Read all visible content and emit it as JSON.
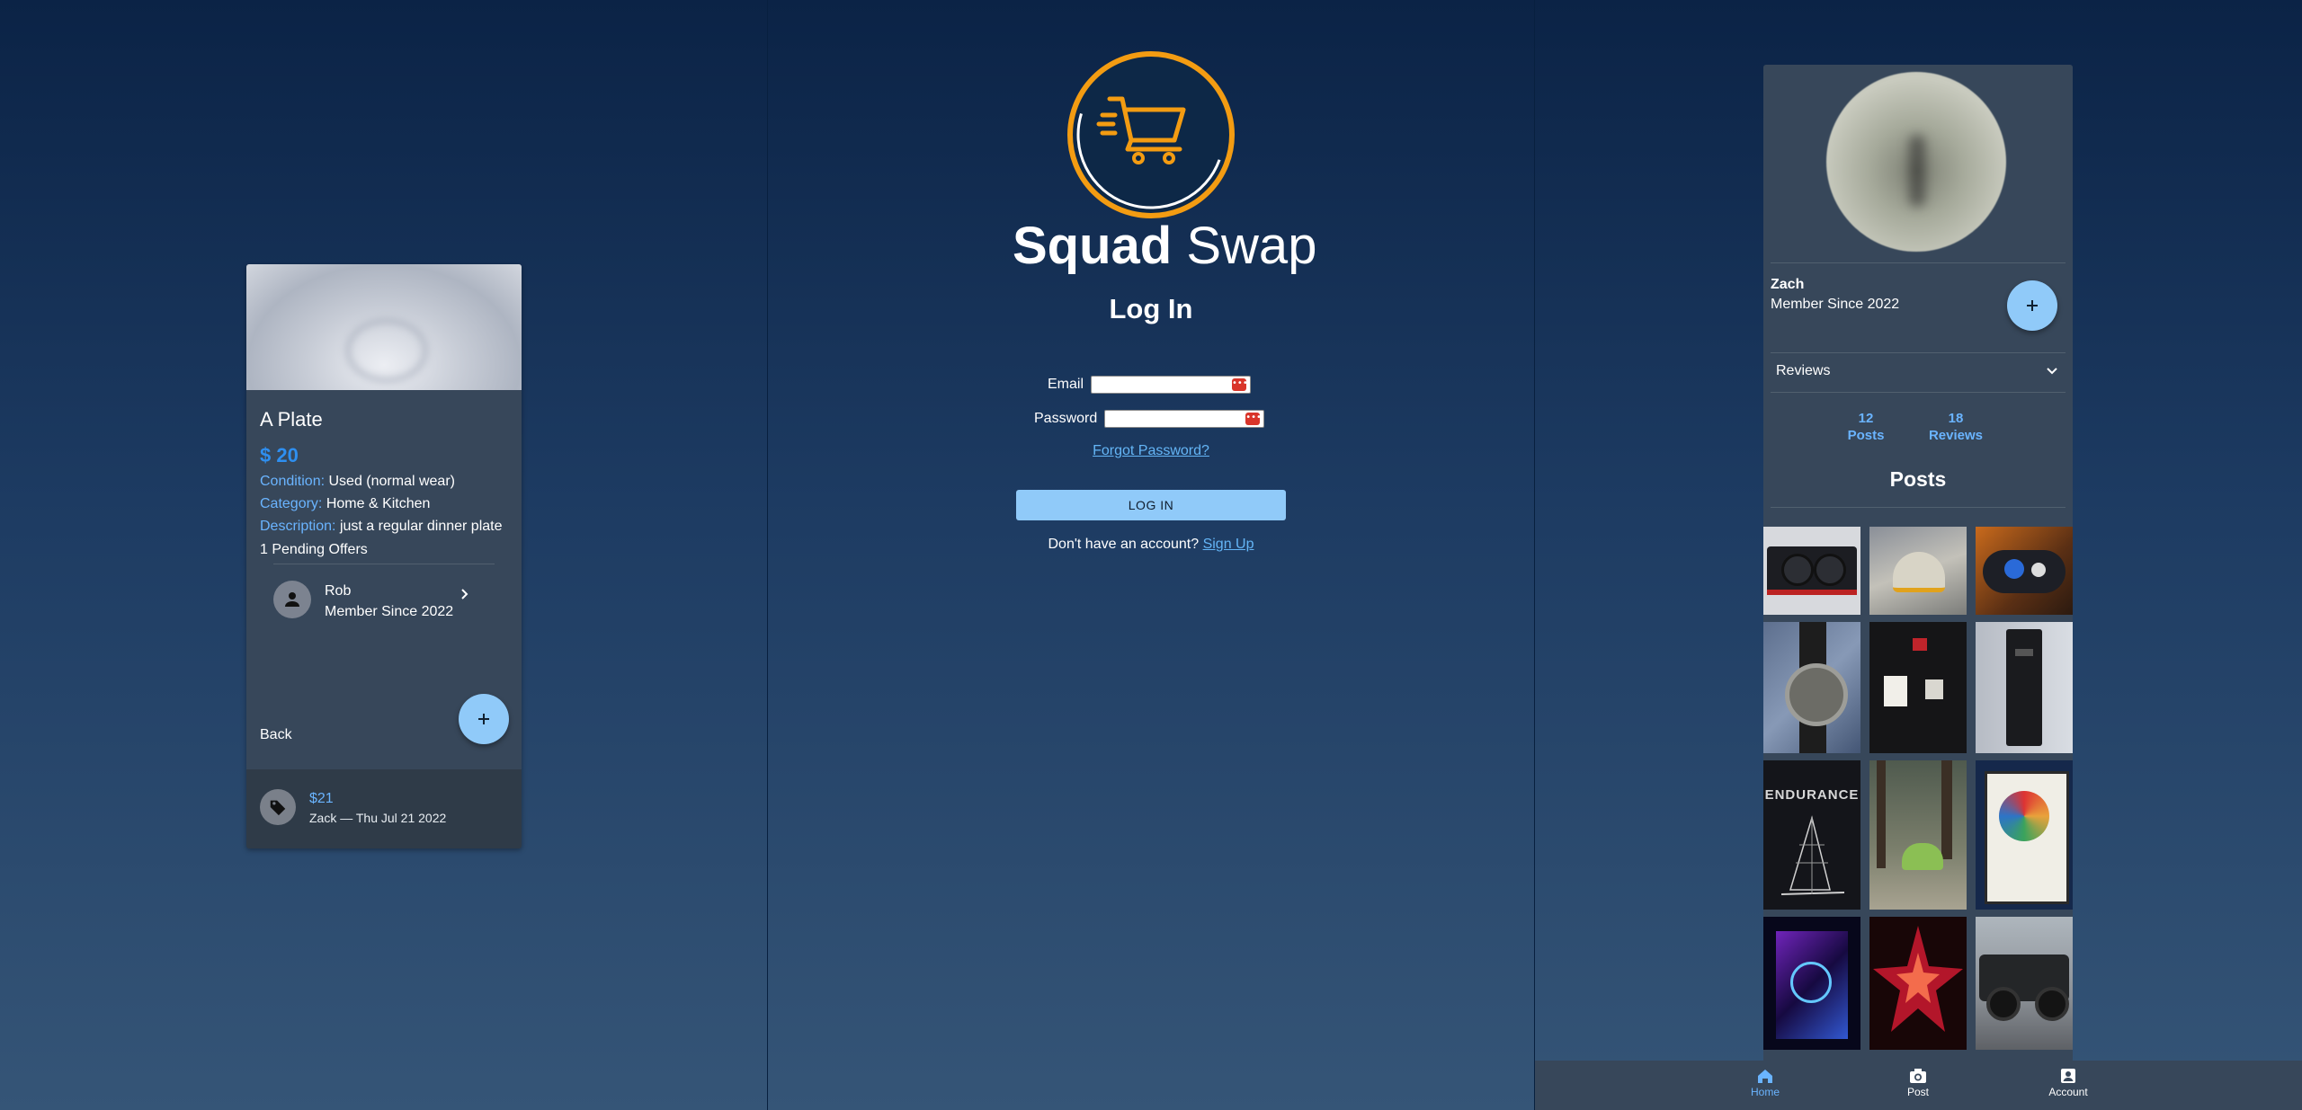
{
  "item": {
    "title": "A Plate",
    "price": "$ 20",
    "condition_label": "Condition:",
    "condition_value": "Used (normal wear)",
    "category_label": "Category:",
    "category_value": "Home & Kitchen",
    "description_label": "Description:",
    "description_value": "just a regular dinner plate",
    "pending": "1 Pending Offers",
    "seller_name": "Rob",
    "seller_since": "Member Since 2022",
    "back": "Back",
    "offer_amount": "$21",
    "offer_meta": "Zack — Thu Jul 21 2022"
  },
  "login": {
    "brand_bold": "Squad",
    "brand_regular": "Swap",
    "title": "Log In",
    "email_label": "Email",
    "email_value": "",
    "password_label": "Password",
    "password_value": "",
    "forgot": "Forgot Password?",
    "button": "LOG IN",
    "signup_prompt": "Don't have an account?",
    "signup_link": "Sign Up",
    "accent": "#f39c12"
  },
  "profile": {
    "name": "Zach",
    "since": "Member Since 2022",
    "reviews_label": "Reviews",
    "posts_count": "12",
    "posts_label": "Posts",
    "reviews_count": "18",
    "reviews_stat_label": "Reviews",
    "posts_title": "Posts",
    "post_thumbnails": [
      "graphics-card",
      "tent-on-rocks",
      "game-controller",
      "wristwatch",
      "black-t-shirt",
      "gpu-box",
      "endurance-book",
      "tent-in-forest",
      "framed-art",
      "gaming-pc-rgb",
      "star-lantern",
      "black-jeep"
    ],
    "endurance_cover_text": "ENDURANCE"
  },
  "nav": {
    "home": "Home",
    "post": "Post",
    "account": "Account"
  }
}
